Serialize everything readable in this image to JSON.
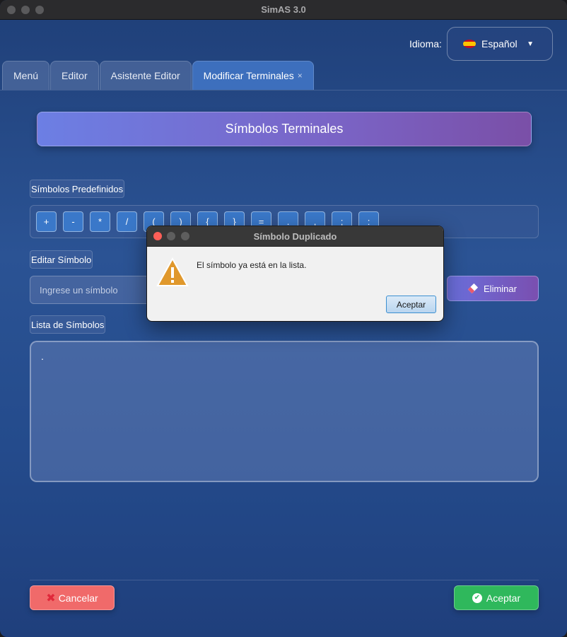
{
  "window": {
    "title": "SimAS 3.0"
  },
  "language": {
    "label": "Idioma:",
    "selected": "Español"
  },
  "tabs": [
    {
      "label": "Menú"
    },
    {
      "label": "Editor"
    },
    {
      "label": "Asistente Editor"
    },
    {
      "label": "Modificar Terminales",
      "close": "×"
    }
  ],
  "header": {
    "title": "Símbolos Terminales"
  },
  "predefined": {
    "label": "Símbolos Predefinidos",
    "symbols": [
      "+",
      "-",
      "*",
      "/",
      "(",
      ")",
      "{",
      "}",
      "=",
      ".",
      ",",
      ";",
      ":"
    ]
  },
  "edit": {
    "label": "Editar Símbolo",
    "placeholder": "Ingrese un símbolo",
    "delete_label": "Eliminar"
  },
  "list": {
    "label": "Lista de Símbolos",
    "items": [
      "."
    ]
  },
  "footer": {
    "cancel_label": "Cancelar",
    "accept_label": "Aceptar"
  },
  "dialog": {
    "title": "Símbolo Duplicado",
    "message": "El símbolo ya está en la lista.",
    "ok_label": "Aceptar"
  }
}
